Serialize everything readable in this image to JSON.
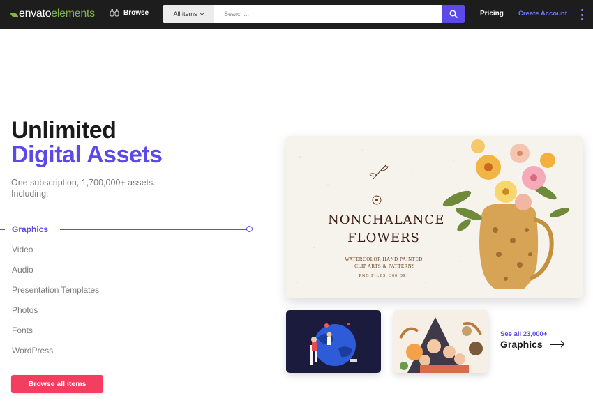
{
  "nav": {
    "logo_word1": "envato",
    "logo_word2": "elements",
    "browse_label": "Browse",
    "search": {
      "filter_label": "All items",
      "placeholder": "Search..."
    },
    "pricing_label": "Pricing",
    "create_account_label": "Create Account"
  },
  "hero": {
    "title_line1": "Unlimited",
    "title_line2": "Digital Assets",
    "subtitle_line1": "One subscription, 1,700,000+ assets.",
    "subtitle_line2": "Including:"
  },
  "categories": [
    {
      "label": "Graphics",
      "active": true
    },
    {
      "label": "Video",
      "active": false
    },
    {
      "label": "Audio",
      "active": false
    },
    {
      "label": "Presentation Templates",
      "active": false
    },
    {
      "label": "Photos",
      "active": false
    },
    {
      "label": "Fonts",
      "active": false
    },
    {
      "label": "WordPress",
      "active": false
    }
  ],
  "browse_all_label": "Browse all items",
  "featured": {
    "title_line1": "NONCHALANCE",
    "title_line2": "FLOWERS",
    "desc_line1": "WATERCOLOR HAND PAINTED",
    "desc_line2": "·CLIP ARTS & PATTERNS",
    "desc_line3": "PNG FILES, 300 DPI"
  },
  "see_all": {
    "count_label": "See all 23,000+",
    "category_label": "Graphics"
  },
  "colors": {
    "nav_bg": "#1d1d1d",
    "brand_green": "#82b541",
    "accent": "#5b4ae8",
    "cta": "#f43d5f",
    "link": "#6b7bff"
  }
}
